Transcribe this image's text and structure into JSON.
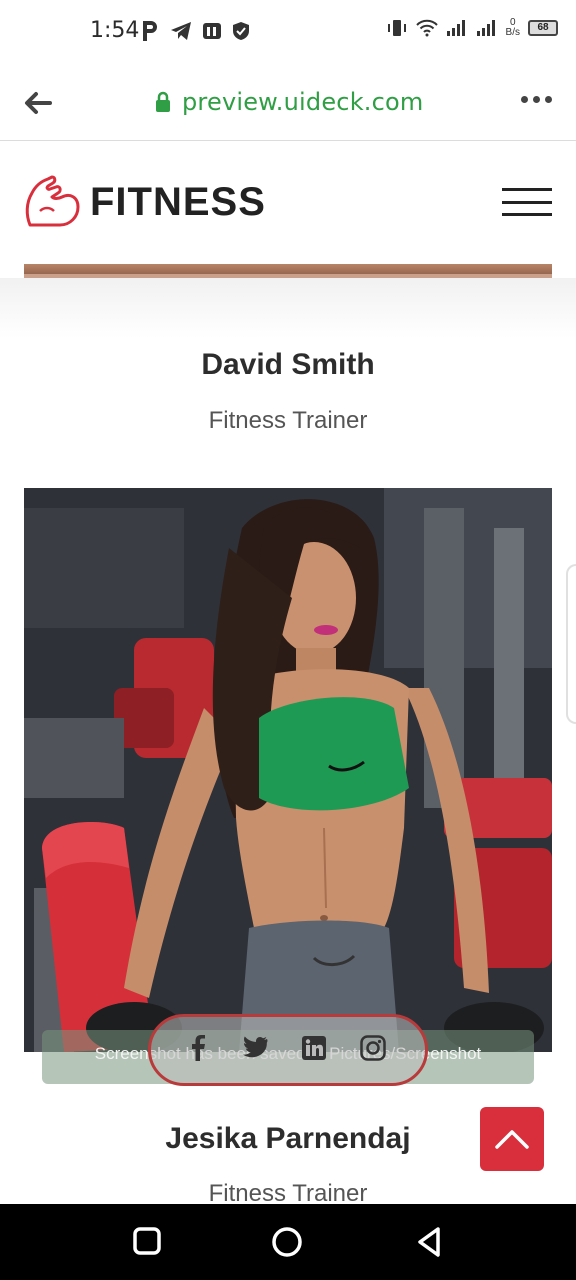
{
  "status_bar": {
    "time": "1:54",
    "battery": "68",
    "net_speed_value": "0",
    "net_speed_unit": "B/s"
  },
  "browser": {
    "url": "preview.uideck.com"
  },
  "site": {
    "logo_text": "FITNESS"
  },
  "team": [
    {
      "name": "David Smith",
      "role": "Fitness Trainer"
    },
    {
      "name": "Jesika Parnendaj",
      "role": "Fitness Trainer"
    }
  ],
  "social": [
    "facebook-icon",
    "twitter-icon",
    "linkedin-icon",
    "instagram-icon"
  ],
  "toast": {
    "message": "Screenshot has been saved to Pictures/Screenshot"
  },
  "colors": {
    "accent": "#d92f3c",
    "url_green": "#2f9e44"
  }
}
